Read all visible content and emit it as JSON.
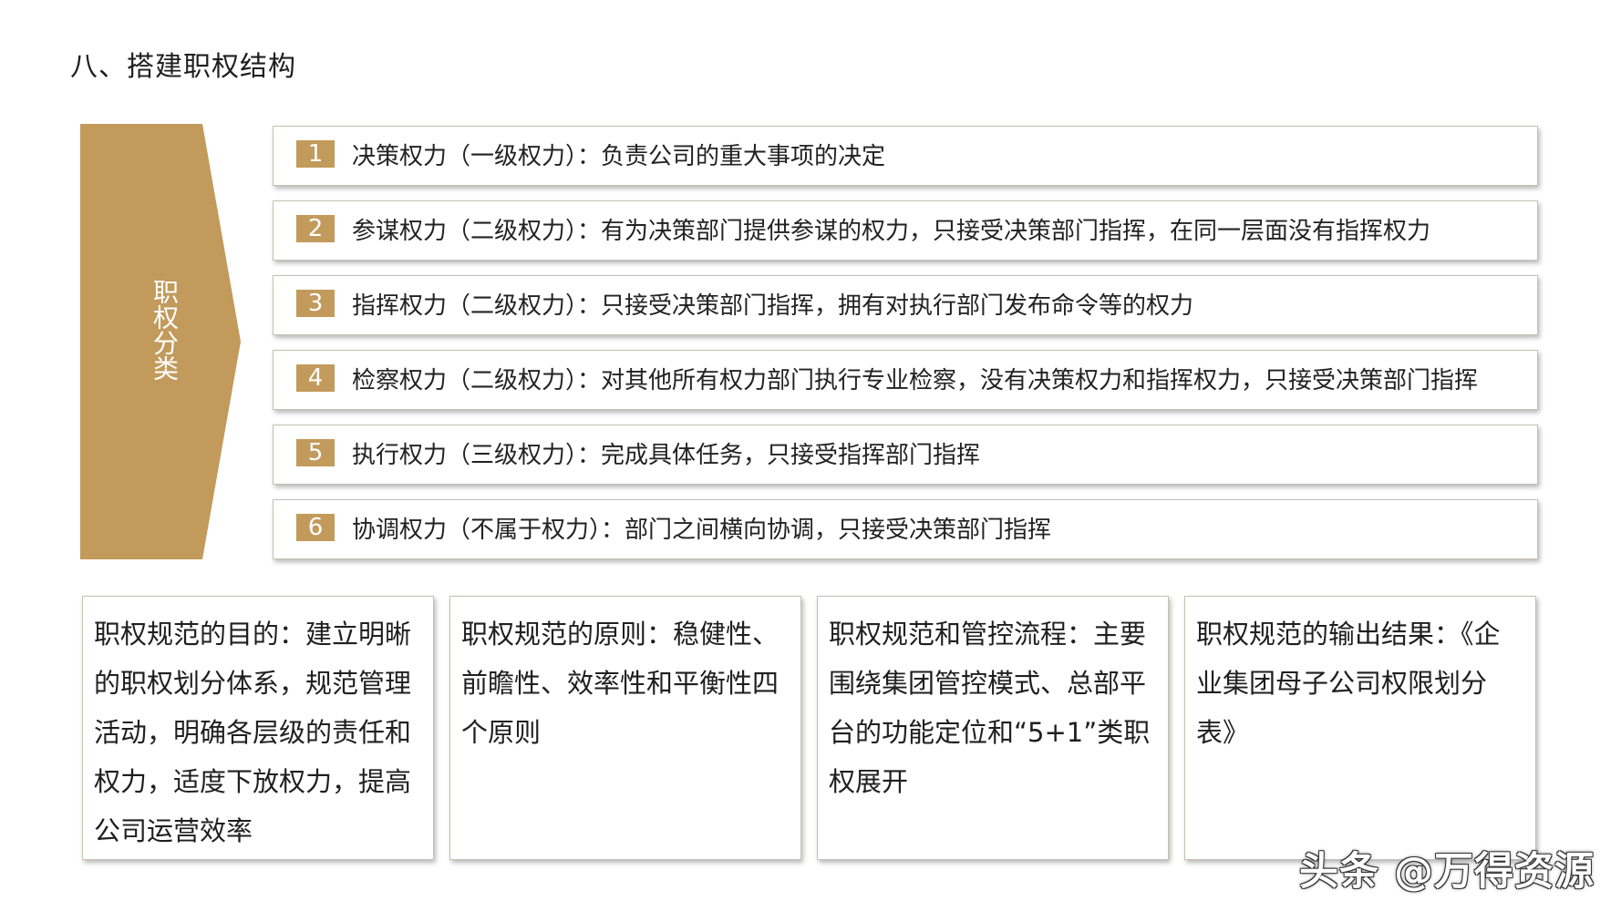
{
  "title": "八、搭建职权结构",
  "category_label": "职权分类",
  "colors": {
    "accent": "#c29a5b",
    "border": "#c9c0b2"
  },
  "rows": [
    {
      "num": "1",
      "text": "决策权力（一级权力）：负责公司的重大事项的决定"
    },
    {
      "num": "2",
      "text": "参谋权力（二级权力）：有为决策部门提供参谋的权力，只接受决策部门指挥，在同一层面没有指挥权力"
    },
    {
      "num": "3",
      "text": "指挥权力（二级权力）：只接受决策部门指挥，拥有对执行部门发布命令等的权力"
    },
    {
      "num": "4",
      "text": "检察权力（二级权力）：对其他所有权力部门执行专业检察，没有决策权力和指挥权力，只接受决策部门指挥"
    },
    {
      "num": "5",
      "text": "执行权力（三级权力）：完成具体任务，只接受指挥部门指挥"
    },
    {
      "num": "6",
      "text": "协调权力（不属于权力）：部门之间横向协调，只接受决策部门指挥"
    }
  ],
  "boxes": [
    {
      "text": "职权规范的目的：建立明晰的职权划分体系，规范管理活动，明确各层级的责任和权力，适度下放权力，提高公司运营效率"
    },
    {
      "text": "职权规范的原则：稳健性、前瞻性、效率性和平衡性四个原则"
    },
    {
      "text": "职权规范和管控流程：主要围绕集团管控模式、总部平台的功能定位和“5+1”类职权展开"
    },
    {
      "text": "职权规范的输出结果：《企业集团母子公司权限划分表》"
    }
  ],
  "watermark": "头条 @万得资源"
}
